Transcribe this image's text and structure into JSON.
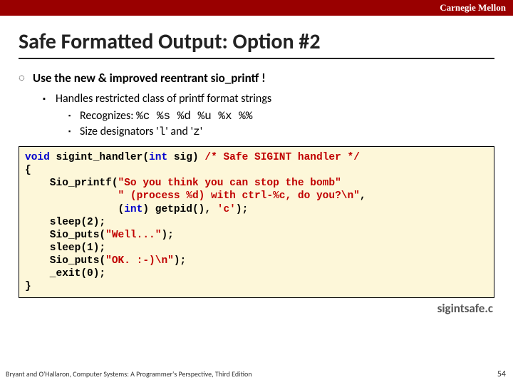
{
  "header": {
    "org": "Carnegie Mellon"
  },
  "title": "Safe Formatted Output: Option #2",
  "bullets": {
    "b1": "Use the new & improved reentrant sio_printf !",
    "b2": "Handles restricted class of printf format strings",
    "b3a_pre": "Recognizes: ",
    "b3a_code": "%c %s %d %u %x %%",
    "b3b_pre": "Size designators '",
    "b3b_c1": "l",
    "b3b_mid": "' and '",
    "b3b_c2": "z",
    "b3b_post": "'"
  },
  "code": {
    "l1_a": "void",
    "l1_b": " sigint_handler(",
    "l1_c": "int",
    "l1_d": " sig) ",
    "l1_e": "/* Safe SIGINT handler */",
    "l2": "{",
    "l3_a": "    Sio_printf(",
    "l3_b": "\"So you think you can stop the bomb\"",
    "l4_a": "               ",
    "l4_b": "\" (process %d) with ctrl-%c, do you?\\n\"",
    "l4_c": ",",
    "l5_a": "               (",
    "l5_b": "int",
    "l5_c": ") getpid(), ",
    "l5_d": "'c'",
    "l5_e": ");",
    "l6": "    sleep(2);",
    "l7_a": "    Sio_puts(",
    "l7_b": "\"Well...\"",
    "l7_c": ");",
    "l8": "    sleep(1);",
    "l9_a": "    Sio_puts(",
    "l9_b": "\"OK. :-)\\n\"",
    "l9_c": ");",
    "l10": "    _exit(0);",
    "l11": "}"
  },
  "filename": "sigintsafe.c",
  "footer": {
    "cite": "Bryant and O'Hallaron, Computer Systems: A Programmer's Perspective, Third Edition",
    "page": "54"
  }
}
